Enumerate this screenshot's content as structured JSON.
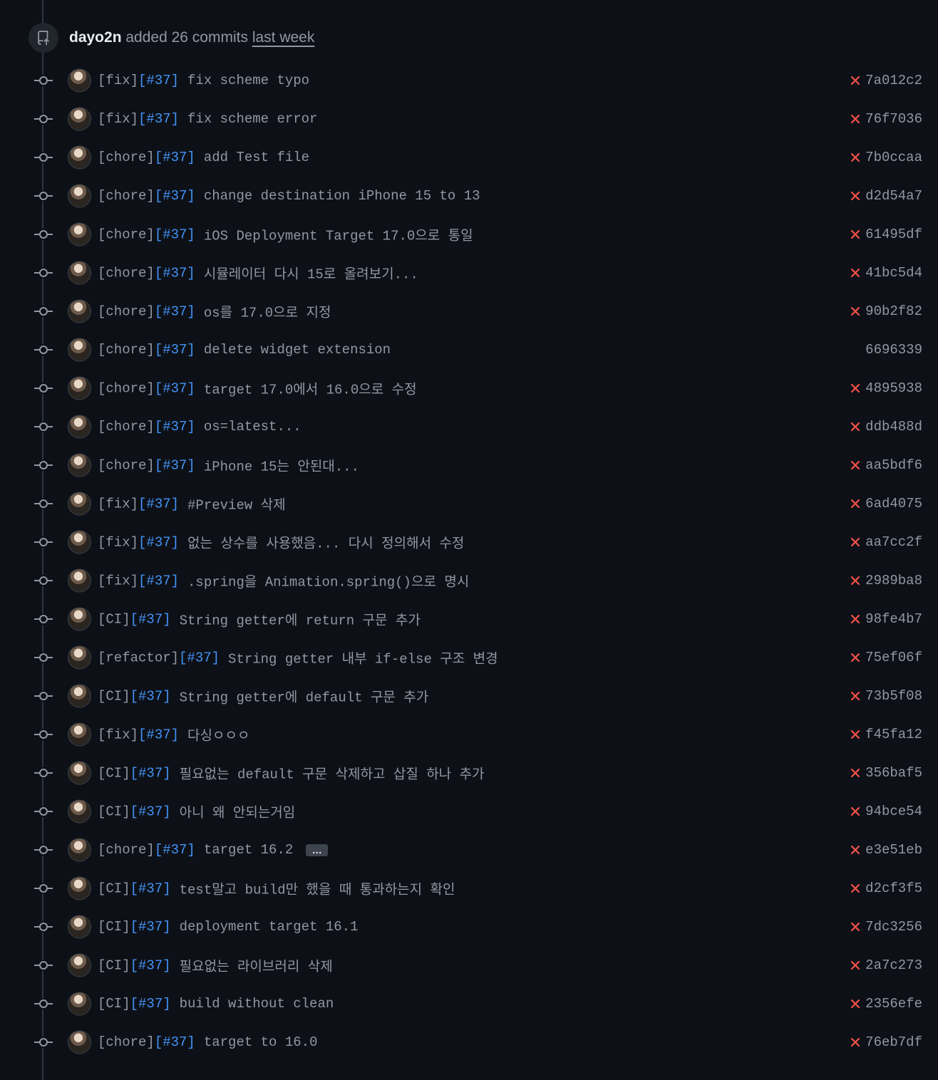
{
  "header": {
    "author": "dayo2n",
    "action": "added 26 commits",
    "when": "last week"
  },
  "colors": {
    "background": "#0d1117",
    "text_muted": "#9198a1",
    "issue_link": "#4493f8",
    "failure": "#f85149"
  },
  "commits": [
    {
      "tag": "[fix]",
      "issue": "[#37]",
      "text": "fix scheme typo",
      "status": "failure",
      "sha": "7a012c2"
    },
    {
      "tag": "[fix]",
      "issue": "[#37]",
      "text": "fix scheme error",
      "status": "failure",
      "sha": "76f7036"
    },
    {
      "tag": "[chore]",
      "issue": "[#37]",
      "text": "add Test file",
      "status": "failure",
      "sha": "7b0ccaa"
    },
    {
      "tag": "[chore]",
      "issue": "[#37]",
      "text": "change destination iPhone 15 to 13",
      "status": "failure",
      "sha": "d2d54a7"
    },
    {
      "tag": "[chore]",
      "issue": "[#37]",
      "text": "iOS Deployment Target 17.0으로 통일",
      "status": "failure",
      "sha": "61495df"
    },
    {
      "tag": "[chore]",
      "issue": "[#37]",
      "text": "시뮬레이터 다시 15로 올려보기...",
      "status": "failure",
      "sha": "41bc5d4"
    },
    {
      "tag": "[chore]",
      "issue": "[#37]",
      "text": "os를 17.0으로 지정",
      "status": "failure",
      "sha": "90b2f82"
    },
    {
      "tag": "[chore]",
      "issue": "[#37]",
      "text": "delete widget extension",
      "status": "none",
      "sha": "6696339"
    },
    {
      "tag": "[chore]",
      "issue": "[#37]",
      "text": "target 17.0에서 16.0으로 수정",
      "status": "failure",
      "sha": "4895938"
    },
    {
      "tag": "[chore]",
      "issue": "[#37]",
      "text": "os=latest...",
      "status": "failure",
      "sha": "ddb488d"
    },
    {
      "tag": "[chore]",
      "issue": "[#37]",
      "text": "iPhone 15는 안된대...",
      "status": "failure",
      "sha": "aa5bdf6"
    },
    {
      "tag": "[fix]",
      "issue": "[#37]",
      "text": "#Preview 삭제",
      "status": "failure",
      "sha": "6ad4075"
    },
    {
      "tag": "[fix]",
      "issue": "[#37]",
      "text": "없는 상수를 사용했음... 다시 정의해서 수정",
      "status": "failure",
      "sha": "aa7cc2f"
    },
    {
      "tag": "[fix]",
      "issue": "[#37]",
      "text": ".spring을 Animation.spring()으로 명시",
      "status": "failure",
      "sha": "2989ba8"
    },
    {
      "tag": "[CI]",
      "issue": "[#37]",
      "text": "String getter에 return 구문 추가",
      "status": "failure",
      "sha": "98fe4b7"
    },
    {
      "tag": "[refactor]",
      "issue": "[#37]",
      "text": "String getter 내부 if-else 구조 변경",
      "status": "failure",
      "sha": "75ef06f"
    },
    {
      "tag": "[CI]",
      "issue": "[#37]",
      "text": "String getter에 default 구문 추가",
      "status": "failure",
      "sha": "73b5f08"
    },
    {
      "tag": "[fix]",
      "issue": "[#37]",
      "text": "다싱ㅇㅇㅇ",
      "status": "failure",
      "sha": "f45fa12"
    },
    {
      "tag": "[CI]",
      "issue": "[#37]",
      "text": "필요없는 default 구문 삭제하고 삽질 하나 추가",
      "status": "failure",
      "sha": "356baf5"
    },
    {
      "tag": "[CI]",
      "issue": "[#37]",
      "text": "아니 왜 안되는거임",
      "status": "failure",
      "sha": "94bce54"
    },
    {
      "tag": "[chore]",
      "issue": "[#37]",
      "text": "target 16.2",
      "status": "failure",
      "sha": "e3e51eb",
      "has_more": true,
      "more_label": "…"
    },
    {
      "tag": "[CI]",
      "issue": "[#37]",
      "text": "test말고 build만 했을 때 통과하는지 확인",
      "status": "failure",
      "sha": "d2cf3f5"
    },
    {
      "tag": "[CI]",
      "issue": "[#37]",
      "text": "deployment target 16.1",
      "status": "failure",
      "sha": "7dc3256"
    },
    {
      "tag": "[CI]",
      "issue": "[#37]",
      "text": "필요없는 라이브러리 삭제",
      "status": "failure",
      "sha": "2a7c273"
    },
    {
      "tag": "[CI]",
      "issue": "[#37]",
      "text": "build without clean",
      "status": "failure",
      "sha": "2356efe"
    },
    {
      "tag": "[chore]",
      "issue": "[#37]",
      "text": "target to 16.0",
      "status": "failure",
      "sha": "76eb7df"
    }
  ]
}
